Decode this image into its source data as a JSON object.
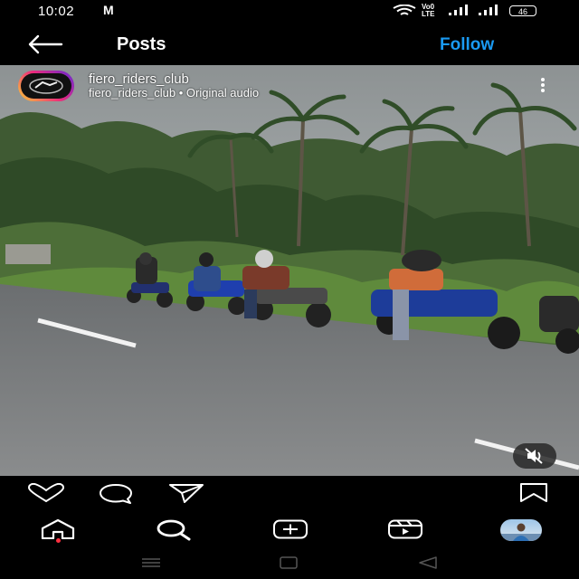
{
  "status_bar": {
    "time": "10:02",
    "mail_glyph": "M",
    "volte_top": "Vo0",
    "volte_bottom": "LTE",
    "battery": "46"
  },
  "header": {
    "title": "Posts",
    "follow_label": "Follow",
    "follow_color": "#1a9af2"
  },
  "post": {
    "account": "fiero_riders_club",
    "subtitle": "fiero_riders_club • Original audio",
    "media_description_icon": "video-frame"
  },
  "actions": {
    "icons": [
      "heart-icon",
      "comment-icon",
      "share-icon",
      "bookmark-icon"
    ]
  },
  "nav": {
    "icons": [
      "home-icon",
      "search-icon",
      "create-icon",
      "reels-icon",
      "profile-avatar"
    ],
    "notification_color": "#ff3040"
  }
}
